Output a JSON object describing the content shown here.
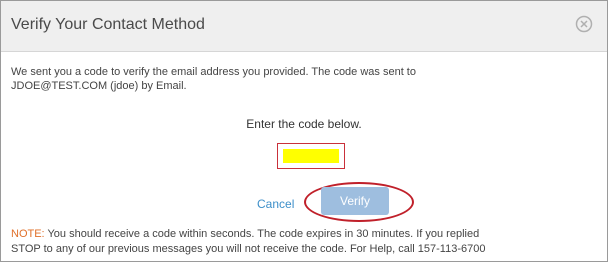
{
  "dialog": {
    "title": "Verify Your Contact Method",
    "close_icon": "close-circle-icon"
  },
  "message": {
    "line1": "We sent you a code to verify the email address you provided. The code was sent to",
    "line2": "JDOE@TEST.COM (jdoe) by Email."
  },
  "code_prompt": "Enter the code below.",
  "code_input": {
    "value": "",
    "highlight_color": "#ffff00",
    "border_color": "#c9303a"
  },
  "actions": {
    "cancel_label": "Cancel",
    "verify_label": "Verify",
    "verify_color": "#9ebedf",
    "highlight_color": "#c0202a"
  },
  "note": {
    "label": "NOTE:",
    "line1": " You should receive a code within seconds. The code expires in 30 minutes. If you replied",
    "line2": "STOP to any of our previous messages you will not receive the code. For Help, call 157-113-6700",
    "label_color": "#e0702a"
  }
}
